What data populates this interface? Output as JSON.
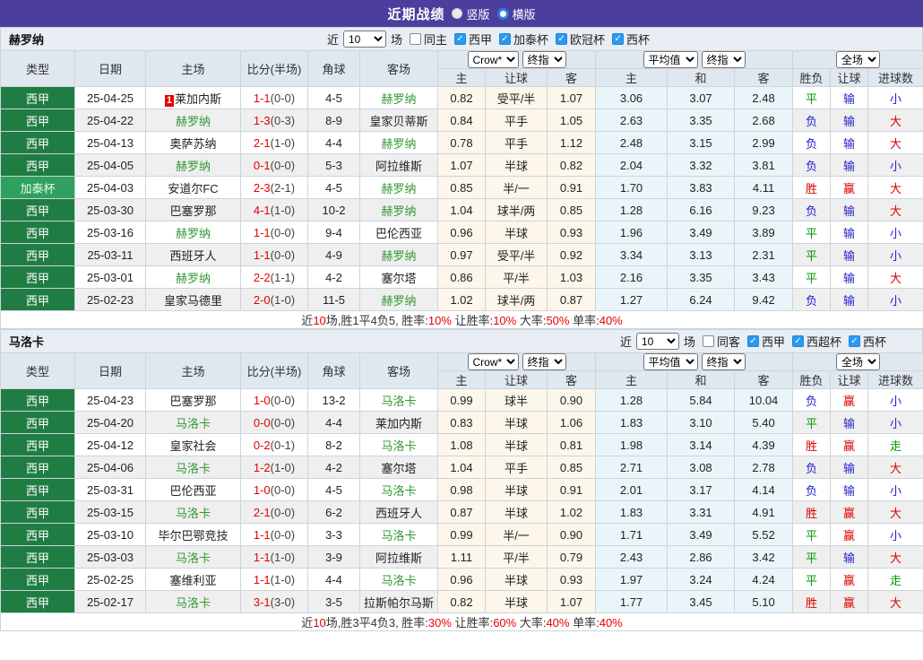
{
  "colors": {
    "topbar_purple": "#4b3e9d",
    "league_green": "#1f7d44",
    "cup_green": "#2fa05e",
    "team_green": "#339933",
    "score_red": "#e60000",
    "win_red": "#dd0000",
    "draw_green": "#009900",
    "lose_blue": "#2323cc",
    "checkbox_blue": "#2a99f0",
    "odds_cream_bg": "#fdf6ea",
    "avg_blue_bg": "#eaf5f9",
    "header_bg": "#dfe7ef"
  },
  "title_bar": {
    "title": "近期战绩",
    "vertical_label": "竖版",
    "horizontal_label": "横版",
    "vertical_checked": false,
    "horizontal_checked": true
  },
  "table": {
    "main_headers": [
      "类型",
      "日期",
      "主场",
      "比分(半场)",
      "角球",
      "客场"
    ],
    "sub_headers": [
      "主",
      "让球",
      "客",
      "主",
      "和",
      "客",
      "胜负",
      "让球",
      "进球数"
    ],
    "selects": {
      "provider": "Crow*",
      "provider_stage": "终指",
      "average": "平均值",
      "average_stage": "终指",
      "scope": "全场"
    }
  },
  "sections": [
    {
      "team": "赫罗纳",
      "filter": {
        "prefix": "近",
        "count": "10",
        "suffix": "场",
        "same_label": "同主",
        "same_checked": false,
        "leagues": [
          {
            "label": "西甲",
            "checked": true
          },
          {
            "label": "加泰杯",
            "checked": true
          },
          {
            "label": "欧冠杯",
            "checked": true
          },
          {
            "label": "西杯",
            "checked": true
          }
        ]
      },
      "rows": [
        {
          "type": "西甲",
          "type_style": "league",
          "date": "25-04-25",
          "home": "莱加内斯",
          "home_green": false,
          "home_badge": "1",
          "score": "1-1",
          "half": "(0-0)",
          "corners": "4-5",
          "away": "赫罗纳",
          "away_green": true,
          "odds_home": "0.82",
          "handicap": "受平/半",
          "odds_away": "1.07",
          "avg_home": "3.06",
          "avg_draw": "3.07",
          "avg_away": "2.48",
          "result": "平",
          "handicap_result": "输",
          "goals": "小"
        },
        {
          "type": "西甲",
          "type_style": "league",
          "date": "25-04-22",
          "home": "赫罗纳",
          "home_green": true,
          "score": "1-3",
          "half": "(0-3)",
          "corners": "8-9",
          "away": "皇家贝蒂斯",
          "away_green": false,
          "odds_home": "0.84",
          "handicap": "平手",
          "odds_away": "1.05",
          "avg_home": "2.63",
          "avg_draw": "3.35",
          "avg_away": "2.68",
          "result": "负",
          "handicap_result": "输",
          "goals": "大"
        },
        {
          "type": "西甲",
          "type_style": "league",
          "date": "25-04-13",
          "home": "奥萨苏纳",
          "home_green": false,
          "score": "2-1",
          "half": "(1-0)",
          "corners": "4-4",
          "away": "赫罗纳",
          "away_green": true,
          "odds_home": "0.78",
          "handicap": "平手",
          "odds_away": "1.12",
          "avg_home": "2.48",
          "avg_draw": "3.15",
          "avg_away": "2.99",
          "result": "负",
          "handicap_result": "输",
          "goals": "大"
        },
        {
          "type": "西甲",
          "type_style": "league",
          "date": "25-04-05",
          "home": "赫罗纳",
          "home_green": true,
          "score": "0-1",
          "half": "(0-0)",
          "corners": "5-3",
          "away": "阿拉维斯",
          "away_green": false,
          "odds_home": "1.07",
          "handicap": "半球",
          "odds_away": "0.82",
          "avg_home": "2.04",
          "avg_draw": "3.32",
          "avg_away": "3.81",
          "result": "负",
          "handicap_result": "输",
          "goals": "小"
        },
        {
          "type": "加泰杯",
          "type_style": "cup",
          "date": "25-04-03",
          "home": "安道尔FC",
          "home_green": false,
          "score": "2-3",
          "half": "(2-1)",
          "corners": "4-5",
          "away": "赫罗纳",
          "away_green": true,
          "odds_home": "0.85",
          "handicap": "半/一",
          "odds_away": "0.91",
          "avg_home": "1.70",
          "avg_draw": "3.83",
          "avg_away": "4.11",
          "result": "胜",
          "handicap_result": "赢",
          "goals": "大"
        },
        {
          "type": "西甲",
          "type_style": "league",
          "date": "25-03-30",
          "home": "巴塞罗那",
          "home_green": false,
          "score": "4-1",
          "half": "(1-0)",
          "corners": "10-2",
          "away": "赫罗纳",
          "away_green": true,
          "odds_home": "1.04",
          "handicap": "球半/两",
          "odds_away": "0.85",
          "avg_home": "1.28",
          "avg_draw": "6.16",
          "avg_away": "9.23",
          "result": "负",
          "handicap_result": "输",
          "goals": "大"
        },
        {
          "type": "西甲",
          "type_style": "league",
          "date": "25-03-16",
          "home": "赫罗纳",
          "home_green": true,
          "score": "1-1",
          "half": "(0-0)",
          "corners": "9-4",
          "away": "巴伦西亚",
          "away_green": false,
          "odds_home": "0.96",
          "handicap": "半球",
          "odds_away": "0.93",
          "avg_home": "1.96",
          "avg_draw": "3.49",
          "avg_away": "3.89",
          "result": "平",
          "handicap_result": "输",
          "goals": "小"
        },
        {
          "type": "西甲",
          "type_style": "league",
          "date": "25-03-11",
          "home": "西班牙人",
          "home_green": false,
          "score": "1-1",
          "half": "(0-0)",
          "corners": "4-9",
          "away": "赫罗纳",
          "away_green": true,
          "odds_home": "0.97",
          "handicap": "受平/半",
          "odds_away": "0.92",
          "avg_home": "3.34",
          "avg_draw": "3.13",
          "avg_away": "2.31",
          "result": "平",
          "handicap_result": "输",
          "goals": "小"
        },
        {
          "type": "西甲",
          "type_style": "league",
          "date": "25-03-01",
          "home": "赫罗纳",
          "home_green": true,
          "score": "2-2",
          "half": "(1-1)",
          "corners": "4-2",
          "away": "塞尔塔",
          "away_green": false,
          "odds_home": "0.86",
          "handicap": "平/半",
          "odds_away": "1.03",
          "avg_home": "2.16",
          "avg_draw": "3.35",
          "avg_away": "3.43",
          "result": "平",
          "handicap_result": "输",
          "goals": "大"
        },
        {
          "type": "西甲",
          "type_style": "league",
          "date": "25-02-23",
          "home": "皇家马德里",
          "home_green": false,
          "score": "2-0",
          "half": "(1-0)",
          "corners": "11-5",
          "away": "赫罗纳",
          "away_green": true,
          "odds_home": "1.02",
          "handicap": "球半/两",
          "odds_away": "0.87",
          "avg_home": "1.27",
          "avg_draw": "6.24",
          "avg_away": "9.42",
          "result": "负",
          "handicap_result": "输",
          "goals": "小"
        }
      ],
      "summary": [
        {
          "text": "近",
          "red": false
        },
        {
          "text": "10",
          "red": true
        },
        {
          "text": "场,胜1平4负5, 胜率:",
          "red": false
        },
        {
          "text": "10%",
          "red": true
        },
        {
          "text": " 让胜率:",
          "red": false
        },
        {
          "text": "10%",
          "red": true
        },
        {
          "text": " 大率:",
          "red": false
        },
        {
          "text": "50%",
          "red": true
        },
        {
          "text": " 单率:",
          "red": false
        },
        {
          "text": "40%",
          "red": true
        }
      ]
    },
    {
      "team": "马洛卡",
      "filter": {
        "prefix": "近",
        "count": "10",
        "suffix": "场",
        "same_label": "同客",
        "same_checked": false,
        "leagues": [
          {
            "label": "西甲",
            "checked": true
          },
          {
            "label": "西超杯",
            "checked": true
          },
          {
            "label": "西杯",
            "checked": true
          }
        ]
      },
      "rows": [
        {
          "type": "西甲",
          "type_style": "league",
          "date": "25-04-23",
          "home": "巴塞罗那",
          "home_green": false,
          "score": "1-0",
          "half": "(0-0)",
          "corners": "13-2",
          "away": "马洛卡",
          "away_green": true,
          "odds_home": "0.99",
          "handicap": "球半",
          "odds_away": "0.90",
          "avg_home": "1.28",
          "avg_draw": "5.84",
          "avg_away": "10.04",
          "result": "负",
          "handicap_result": "赢",
          "goals": "小"
        },
        {
          "type": "西甲",
          "type_style": "league",
          "date": "25-04-20",
          "home": "马洛卡",
          "home_green": true,
          "score": "0-0",
          "half": "(0-0)",
          "corners": "4-4",
          "away": "莱加内斯",
          "away_green": false,
          "odds_home": "0.83",
          "handicap": "半球",
          "odds_away": "1.06",
          "avg_home": "1.83",
          "avg_draw": "3.10",
          "avg_away": "5.40",
          "result": "平",
          "handicap_result": "输",
          "goals": "小"
        },
        {
          "type": "西甲",
          "type_style": "league",
          "date": "25-04-12",
          "home": "皇家社会",
          "home_green": false,
          "score": "0-2",
          "half": "(0-1)",
          "corners": "8-2",
          "away": "马洛卡",
          "away_green": true,
          "odds_home": "1.08",
          "handicap": "半球",
          "odds_away": "0.81",
          "avg_home": "1.98",
          "avg_draw": "3.14",
          "avg_away": "4.39",
          "result": "胜",
          "handicap_result": "赢",
          "goals": "走"
        },
        {
          "type": "西甲",
          "type_style": "league",
          "date": "25-04-06",
          "home": "马洛卡",
          "home_green": true,
          "score": "1-2",
          "half": "(1-0)",
          "corners": "4-2",
          "away": "塞尔塔",
          "away_green": false,
          "odds_home": "1.04",
          "handicap": "平手",
          "odds_away": "0.85",
          "avg_home": "2.71",
          "avg_draw": "3.08",
          "avg_away": "2.78",
          "result": "负",
          "handicap_result": "输",
          "goals": "大"
        },
        {
          "type": "西甲",
          "type_style": "league",
          "date": "25-03-31",
          "home": "巴伦西亚",
          "home_green": false,
          "score": "1-0",
          "half": "(0-0)",
          "corners": "4-5",
          "away": "马洛卡",
          "away_green": true,
          "odds_home": "0.98",
          "handicap": "半球",
          "odds_away": "0.91",
          "avg_home": "2.01",
          "avg_draw": "3.17",
          "avg_away": "4.14",
          "result": "负",
          "handicap_result": "输",
          "goals": "小"
        },
        {
          "type": "西甲",
          "type_style": "league",
          "date": "25-03-15",
          "home": "马洛卡",
          "home_green": true,
          "score": "2-1",
          "half": "(0-0)",
          "corners": "6-2",
          "away": "西班牙人",
          "away_green": false,
          "odds_home": "0.87",
          "handicap": "半球",
          "odds_away": "1.02",
          "avg_home": "1.83",
          "avg_draw": "3.31",
          "avg_away": "4.91",
          "result": "胜",
          "handicap_result": "赢",
          "goals": "大"
        },
        {
          "type": "西甲",
          "type_style": "league",
          "date": "25-03-10",
          "home": "毕尔巴鄂竞技",
          "home_green": false,
          "score": "1-1",
          "half": "(0-0)",
          "corners": "3-3",
          "away": "马洛卡",
          "away_green": true,
          "odds_home": "0.99",
          "handicap": "半/一",
          "odds_away": "0.90",
          "avg_home": "1.71",
          "avg_draw": "3.49",
          "avg_away": "5.52",
          "result": "平",
          "handicap_result": "赢",
          "goals": "小"
        },
        {
          "type": "西甲",
          "type_style": "league",
          "date": "25-03-03",
          "home": "马洛卡",
          "home_green": true,
          "score": "1-1",
          "half": "(1-0)",
          "corners": "3-9",
          "away": "阿拉维斯",
          "away_green": false,
          "odds_home": "1.11",
          "handicap": "平/半",
          "odds_away": "0.79",
          "avg_home": "2.43",
          "avg_draw": "2.86",
          "avg_away": "3.42",
          "result": "平",
          "handicap_result": "输",
          "goals": "大"
        },
        {
          "type": "西甲",
          "type_style": "league",
          "date": "25-02-25",
          "home": "塞维利亚",
          "home_green": false,
          "score": "1-1",
          "half": "(1-0)",
          "corners": "4-4",
          "away": "马洛卡",
          "away_green": true,
          "odds_home": "0.96",
          "handicap": "半球",
          "odds_away": "0.93",
          "avg_home": "1.97",
          "avg_draw": "3.24",
          "avg_away": "4.24",
          "result": "平",
          "handicap_result": "赢",
          "goals": "走"
        },
        {
          "type": "西甲",
          "type_style": "league",
          "date": "25-02-17",
          "home": "马洛卡",
          "home_green": true,
          "score": "3-1",
          "half": "(3-0)",
          "corners": "3-5",
          "away": "拉斯帕尔马斯",
          "away_green": false,
          "odds_home": "0.82",
          "handicap": "半球",
          "odds_away": "1.07",
          "avg_home": "1.77",
          "avg_draw": "3.45",
          "avg_away": "5.10",
          "result": "胜",
          "handicap_result": "赢",
          "goals": "大"
        }
      ],
      "summary": [
        {
          "text": "近",
          "red": false
        },
        {
          "text": "10",
          "red": true
        },
        {
          "text": "场,胜3平4负3, 胜率:",
          "red": false
        },
        {
          "text": "30%",
          "red": true
        },
        {
          "text": " 让胜率:",
          "red": false
        },
        {
          "text": "60%",
          "red": true
        },
        {
          "text": " 大率:",
          "red": false
        },
        {
          "text": "40%",
          "red": true
        },
        {
          "text": " 单率:",
          "red": false
        },
        {
          "text": "40%",
          "red": true
        }
      ]
    }
  ]
}
